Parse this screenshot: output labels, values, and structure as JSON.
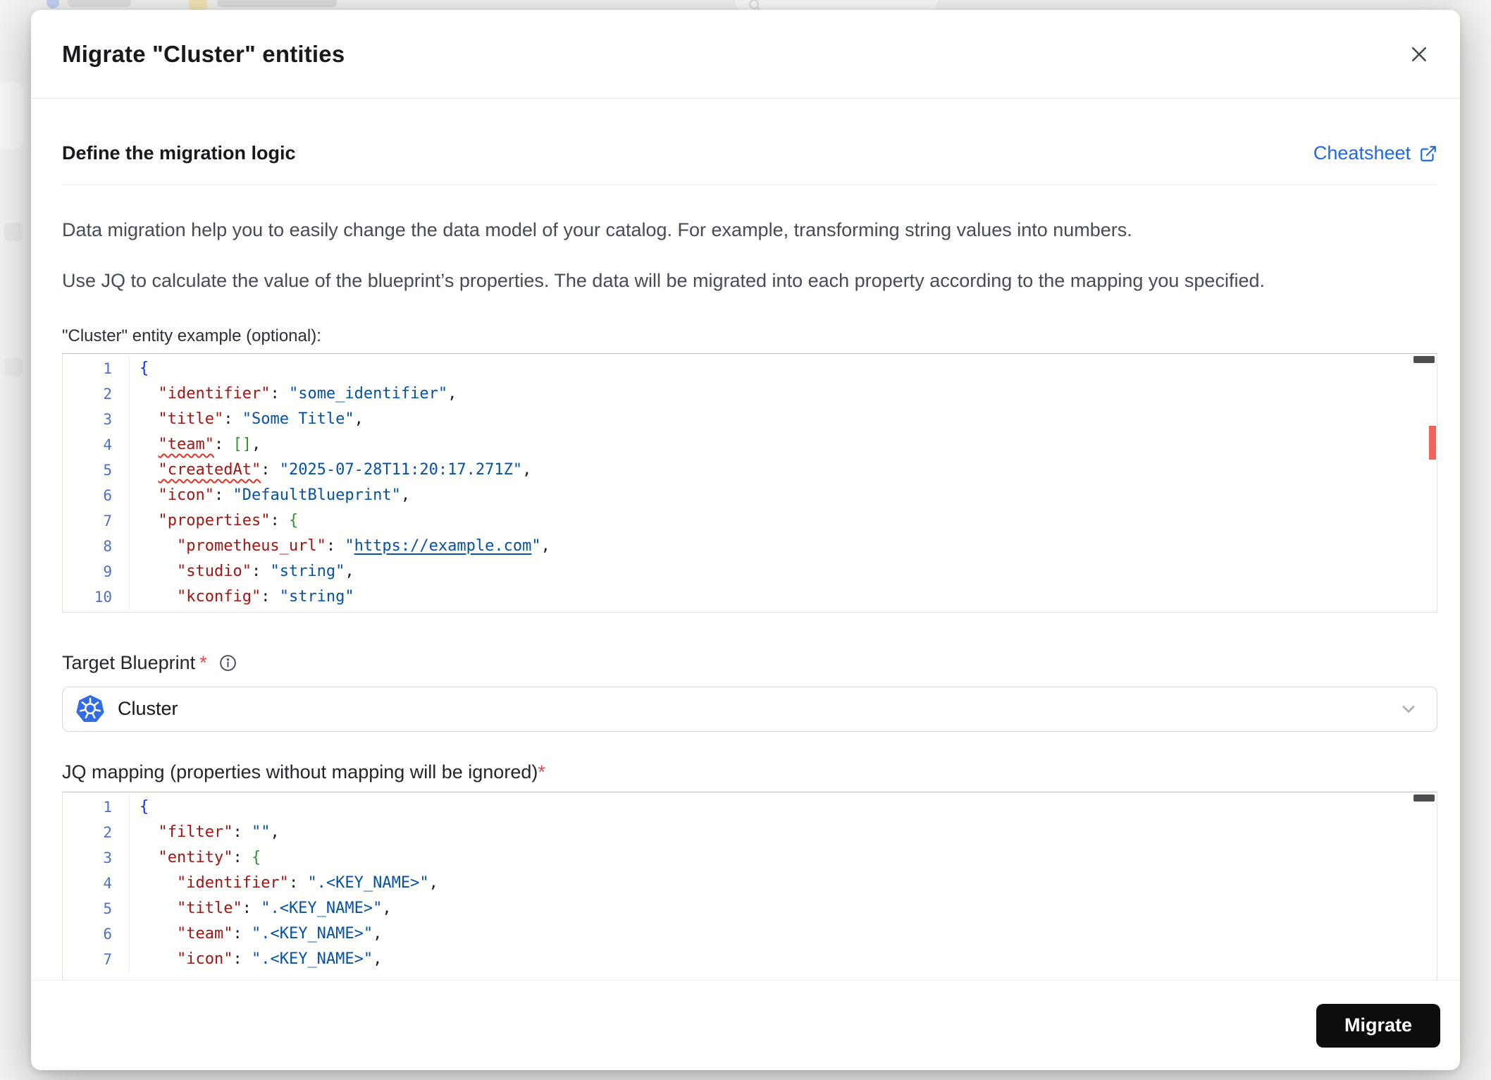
{
  "icons": {
    "close": "close-icon",
    "cheatsheet_external": "external-link-icon",
    "info": "info-icon",
    "target_blueprint": "kubernetes-icon",
    "select_chevron": "chevron-down-icon",
    "backdrop_search": "search-icon",
    "backdrop_folder": "folder-icon"
  },
  "modal": {
    "title": "Migrate \"Cluster\" entities",
    "section": {
      "heading": "Define the migration logic",
      "cheatsheet_label": "Cheatsheet"
    },
    "description": [
      "Data migration help you to easily change the data model of your catalog. For example, transforming string values into numbers.",
      "Use JQ to calculate the value of the blueprint’s properties. The data will be migrated into each property according to the mapping you specified."
    ],
    "entity_example": {
      "label": "\"Cluster\" entity example (optional):",
      "lines": [
        [
          {
            "c": "b",
            "s": "{"
          }
        ],
        [
          {
            "c": "p",
            "s": "  "
          },
          {
            "c": "k",
            "s": "\"identifier\""
          },
          {
            "c": "p",
            "s": ": "
          },
          {
            "c": "v",
            "s": "\"some_identifier\""
          },
          {
            "c": "p",
            "s": ","
          }
        ],
        [
          {
            "c": "p",
            "s": "  "
          },
          {
            "c": "k",
            "s": "\"title\""
          },
          {
            "c": "p",
            "s": ": "
          },
          {
            "c": "v",
            "s": "\"Some Title\""
          },
          {
            "c": "p",
            "s": ","
          }
        ],
        [
          {
            "c": "p",
            "s": "  "
          },
          {
            "c": "k sq",
            "s": "\"team\""
          },
          {
            "c": "p",
            "s": ": "
          },
          {
            "c": "g",
            "s": "[]"
          },
          {
            "c": "p",
            "s": ","
          }
        ],
        [
          {
            "c": "p",
            "s": "  "
          },
          {
            "c": "k sq",
            "s": "\"createdAt\""
          },
          {
            "c": "p",
            "s": ": "
          },
          {
            "c": "v",
            "s": "\"2025-07-28T11:20:17.271Z\""
          },
          {
            "c": "p",
            "s": ","
          }
        ],
        [
          {
            "c": "p",
            "s": "  "
          },
          {
            "c": "k",
            "s": "\"icon\""
          },
          {
            "c": "p",
            "s": ": "
          },
          {
            "c": "v",
            "s": "\"DefaultBlueprint\""
          },
          {
            "c": "p",
            "s": ","
          }
        ],
        [
          {
            "c": "p",
            "s": "  "
          },
          {
            "c": "k",
            "s": "\"properties\""
          },
          {
            "c": "p",
            "s": ": "
          },
          {
            "c": "g",
            "s": "{"
          }
        ],
        [
          {
            "c": "p",
            "s": "    "
          },
          {
            "c": "k",
            "s": "\"prometheus_url\""
          },
          {
            "c": "p",
            "s": ": "
          },
          {
            "c": "v",
            "s": "\""
          },
          {
            "c": "link",
            "s": "https://example.com"
          },
          {
            "c": "v",
            "s": "\""
          },
          {
            "c": "p",
            "s": ","
          }
        ],
        [
          {
            "c": "p",
            "s": "    "
          },
          {
            "c": "k",
            "s": "\"studio\""
          },
          {
            "c": "p",
            "s": ": "
          },
          {
            "c": "v",
            "s": "\"string\""
          },
          {
            "c": "p",
            "s": ","
          }
        ],
        [
          {
            "c": "p",
            "s": "    "
          },
          {
            "c": "k",
            "s": "\"kconfig\""
          },
          {
            "c": "p",
            "s": ": "
          },
          {
            "c": "v",
            "s": "\"string\""
          }
        ]
      ]
    },
    "target_blueprint": {
      "label": "Target Blueprint",
      "required_marker": "*",
      "value": "Cluster"
    },
    "jq_mapping": {
      "label": "JQ mapping (properties without mapping will be ignored)",
      "required_marker": "*",
      "lines": [
        [
          {
            "c": "b",
            "s": "{"
          }
        ],
        [
          {
            "c": "p",
            "s": "  "
          },
          {
            "c": "k",
            "s": "\"filter\""
          },
          {
            "c": "p",
            "s": ": "
          },
          {
            "c": "v",
            "s": "\"\""
          },
          {
            "c": "p",
            "s": ","
          }
        ],
        [
          {
            "c": "p",
            "s": "  "
          },
          {
            "c": "k",
            "s": "\"entity\""
          },
          {
            "c": "p",
            "s": ": "
          },
          {
            "c": "g",
            "s": "{"
          }
        ],
        [
          {
            "c": "p",
            "s": "    "
          },
          {
            "c": "k",
            "s": "\"identifier\""
          },
          {
            "c": "p",
            "s": ": "
          },
          {
            "c": "v",
            "s": "\".<KEY_NAME>\""
          },
          {
            "c": "p",
            "s": ","
          }
        ],
        [
          {
            "c": "p",
            "s": "    "
          },
          {
            "c": "k",
            "s": "\"title\""
          },
          {
            "c": "p",
            "s": ": "
          },
          {
            "c": "v",
            "s": "\".<KEY_NAME>\""
          },
          {
            "c": "p",
            "s": ","
          }
        ],
        [
          {
            "c": "p",
            "s": "    "
          },
          {
            "c": "k",
            "s": "\"team\""
          },
          {
            "c": "p",
            "s": ": "
          },
          {
            "c": "v",
            "s": "\".<KEY_NAME>\""
          },
          {
            "c": "p",
            "s": ","
          }
        ],
        [
          {
            "c": "p",
            "s": "    "
          },
          {
            "c": "k",
            "s": "\"icon\""
          },
          {
            "c": "p",
            "s": ": "
          },
          {
            "c": "v",
            "s": "\".<KEY_NAME>\""
          },
          {
            "c": "p",
            "s": ","
          }
        ]
      ]
    },
    "footer": {
      "migrate_label": "Migrate"
    }
  }
}
